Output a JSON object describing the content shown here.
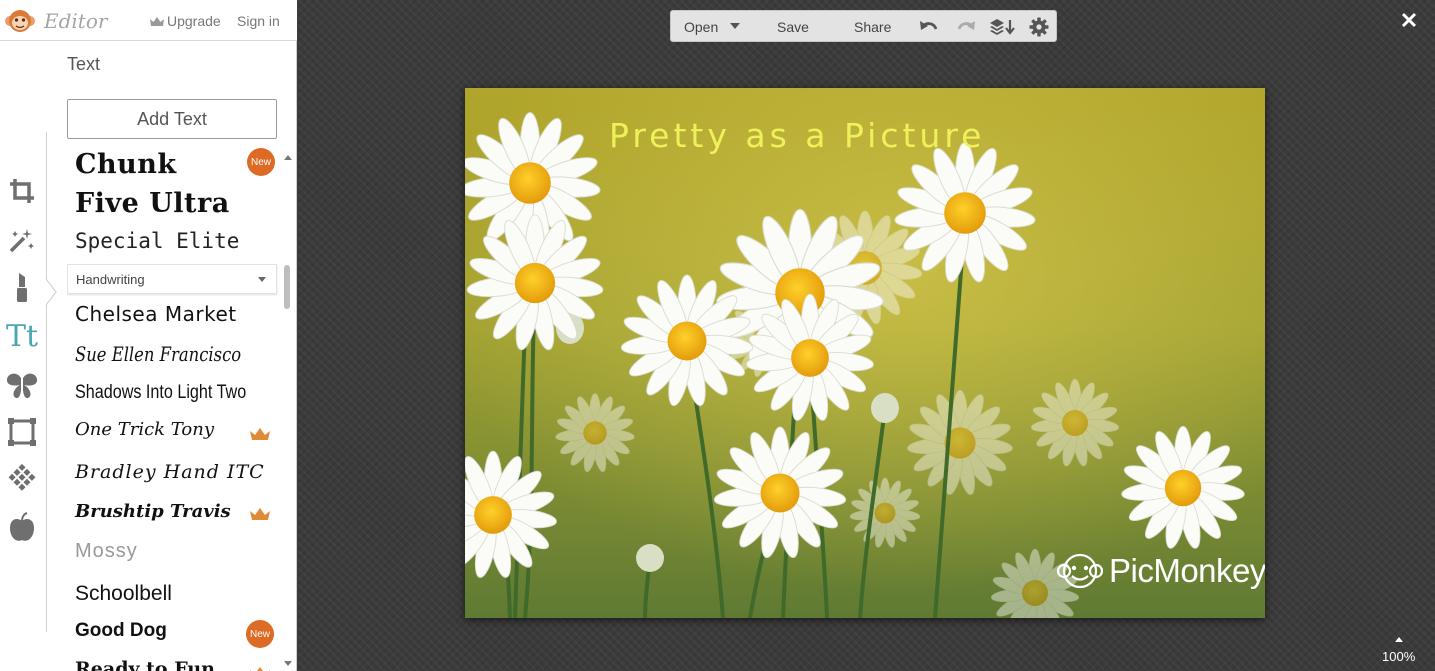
{
  "topbar": {
    "brand": "Editor",
    "upgrade_label": "Upgrade",
    "signin_label": "Sign in"
  },
  "rail": {
    "icons": [
      "crop-icon",
      "magic-wand-icon",
      "lipstick-icon",
      "text-icon",
      "butterfly-icon",
      "frame-icon",
      "texture-icon",
      "apple-icon"
    ],
    "active": "text-icon",
    "text_icon_glyph": "Tt",
    "active_color": "#4ba6b3"
  },
  "pane": {
    "title": "Text",
    "add_text_label": "Add Text",
    "category": "Handwriting",
    "fonts_top": [
      {
        "name": "Chunk Five Ultra",
        "badge": "New"
      },
      {
        "name": "Special Elite"
      }
    ],
    "fonts": [
      {
        "name": "Chelsea Market"
      },
      {
        "name": "Sue Ellen Francisco"
      },
      {
        "name": "Shadows Into Light Two"
      },
      {
        "name": "One Trick Tony",
        "premium": true
      },
      {
        "name": "Bradley Hand ITC"
      },
      {
        "name": "Brushtip Travis",
        "premium": true
      },
      {
        "name": "Mossy"
      },
      {
        "name": "Schoolbell"
      },
      {
        "name": "Good Dog",
        "badge": "New"
      },
      {
        "name": "Ready to Fun",
        "premium": true
      }
    ],
    "badge_color": "#dd6a25",
    "crown_color": "#dd8a3a"
  },
  "toolbar": {
    "open_label": "Open",
    "save_label": "Save",
    "share_label": "Share"
  },
  "canvas": {
    "caption": "Pretty as a Picture",
    "caption_color": "#eef15a",
    "watermark": "PicMonkey"
  },
  "zoom": {
    "level": "100%"
  }
}
